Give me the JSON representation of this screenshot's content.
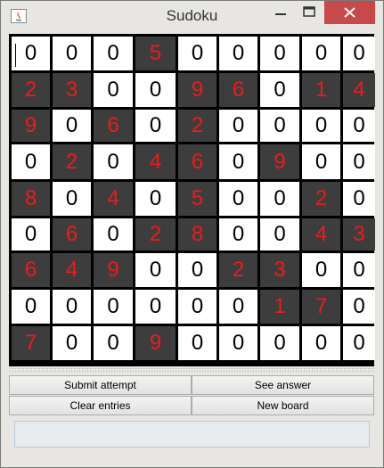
{
  "window": {
    "title": "Sudoku"
  },
  "board": {
    "rows": [
      [
        "0",
        "0",
        "0",
        "5",
        "0",
        "0",
        "0",
        "0",
        "0"
      ],
      [
        "2",
        "3",
        "0",
        "0",
        "9",
        "6",
        "0",
        "1",
        "4"
      ],
      [
        "9",
        "0",
        "6",
        "0",
        "2",
        "0",
        "0",
        "0",
        "0"
      ],
      [
        "0",
        "2",
        "0",
        "4",
        "6",
        "0",
        "9",
        "0",
        "0"
      ],
      [
        "8",
        "0",
        "4",
        "0",
        "5",
        "0",
        "0",
        "2",
        "0"
      ],
      [
        "0",
        "6",
        "0",
        "2",
        "8",
        "0",
        "0",
        "4",
        "3"
      ],
      [
        "6",
        "4",
        "9",
        "0",
        "0",
        "2",
        "3",
        "0",
        "0"
      ],
      [
        "0",
        "0",
        "0",
        "0",
        "0",
        "0",
        "1",
        "7",
        "0"
      ],
      [
        "7",
        "0",
        "0",
        "9",
        "0",
        "0",
        "0",
        "0",
        "0"
      ]
    ],
    "given": [
      [
        0,
        0,
        0,
        1,
        0,
        0,
        0,
        0,
        0
      ],
      [
        1,
        1,
        0,
        0,
        1,
        1,
        0,
        1,
        1
      ],
      [
        1,
        0,
        1,
        0,
        1,
        0,
        0,
        0,
        0
      ],
      [
        0,
        1,
        0,
        1,
        1,
        0,
        1,
        0,
        0
      ],
      [
        1,
        0,
        1,
        0,
        1,
        0,
        0,
        1,
        0
      ],
      [
        0,
        1,
        0,
        1,
        1,
        0,
        0,
        1,
        1
      ],
      [
        1,
        1,
        1,
        0,
        0,
        1,
        1,
        0,
        0
      ],
      [
        0,
        0,
        0,
        0,
        0,
        0,
        1,
        1,
        0
      ],
      [
        1,
        0,
        0,
        1,
        0,
        0,
        0,
        0,
        0
      ]
    ],
    "colors": {
      "given_bg": "#3d3d3d",
      "given_text": "#ee1b1b",
      "editable_bg": "#ffffff",
      "editable_text": "#000000"
    }
  },
  "buttons": {
    "submit": "Submit attempt",
    "see_answer": "See answer",
    "clear": "Clear entries",
    "new_board": "New board"
  },
  "status": {
    "text": ""
  }
}
